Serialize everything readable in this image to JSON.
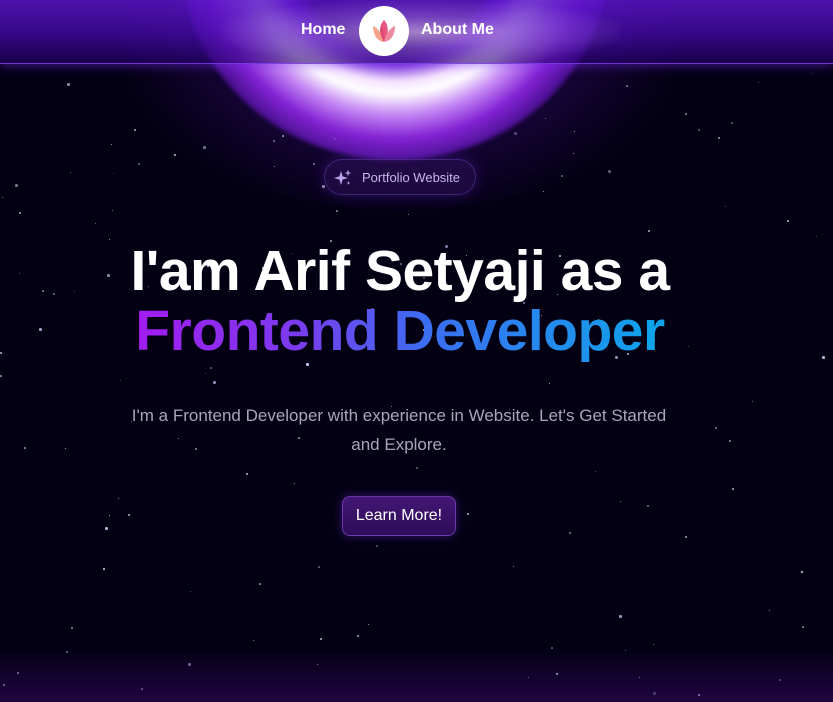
{
  "colors": {
    "background": "#030014",
    "accent_purple": "#7c3aed",
    "gradient_start": "#a21cf0",
    "gradient_end": "#0ea5e9",
    "desc_text": "#a8a5bd"
  },
  "nav": {
    "home_label": "Home",
    "about_label": "About Me",
    "logo_icon": "lotus-icon"
  },
  "badge": {
    "icon": "sparkles-icon",
    "label": "Portfolio Website"
  },
  "hero": {
    "line1": "I'am Arif Setyaji as a",
    "line2": "Frontend Developer",
    "description": "I'm a Frontend Developer with experience in Website. Let's Get Started and Explore.",
    "cta_label": "Learn More!"
  }
}
